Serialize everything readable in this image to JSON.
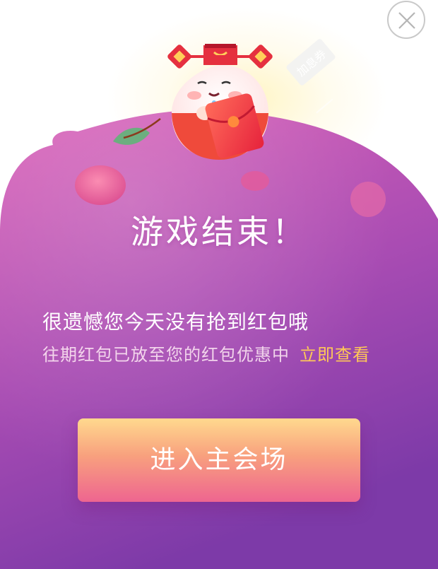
{
  "dialog": {
    "title": "游戏结束！",
    "message": "很遗憾您今天没有抢到红包哦",
    "sub_message": "往期红包已放至您的红包优惠中",
    "view_link": "立即查看",
    "enter_button": "进入主会场",
    "coupon_tag": "加息券"
  },
  "colors": {
    "card_top": "#dc60b9",
    "card_bottom": "#7f3ba9",
    "link": "#ffc857",
    "button_top": "#ffd98e",
    "button_bottom": "#ee6590"
  },
  "icons": [
    "close-icon",
    "mascot-illustration",
    "red-envelope-icon",
    "leaf-icon",
    "coupon-ticket-icon"
  ]
}
